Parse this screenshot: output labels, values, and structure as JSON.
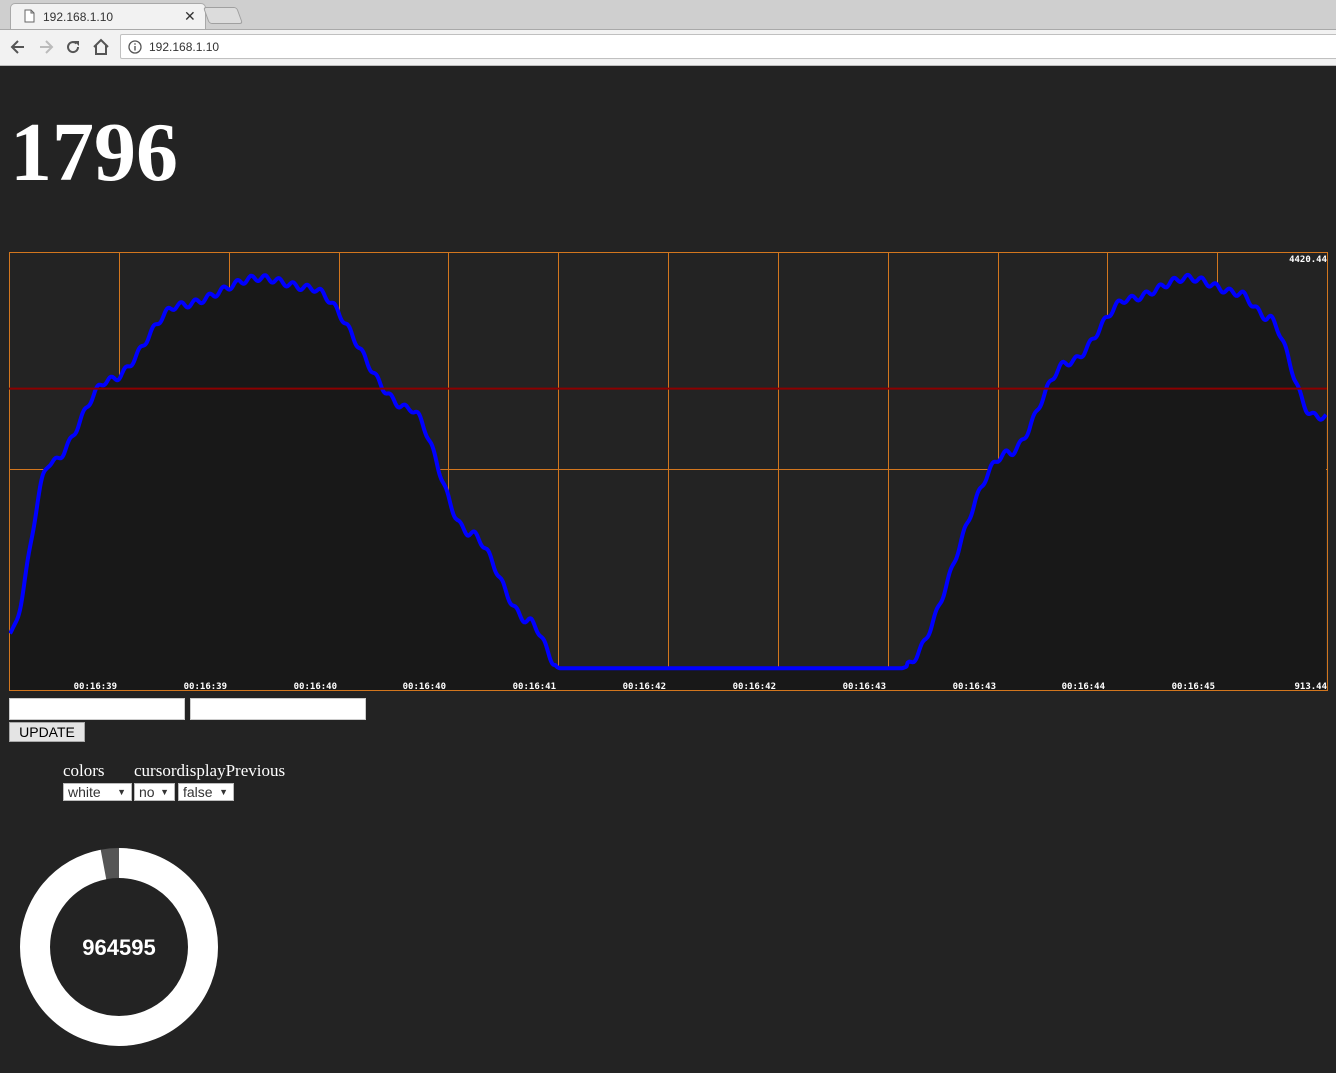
{
  "browser": {
    "tab_title": "192.168.1.10",
    "url": "192.168.1.10"
  },
  "display": {
    "value": "1796"
  },
  "chart_data": {
    "type": "line",
    "ymax_label": "4420.44",
    "ymin_label": "913.44",
    "ylim": [
      913.44,
      4420.44
    ],
    "threshold": 3330,
    "x_ticks": [
      "00:16:39",
      "00:16:39",
      "00:16:40",
      "00:16:40",
      "00:16:41",
      "00:16:42",
      "00:16:42",
      "00:16:43",
      "00:16:43",
      "00:16:44",
      "00:16:45"
    ],
    "series": [
      {
        "color": "#0000ff",
        "points": [
          [
            0,
            1360
          ],
          [
            40,
            2730
          ],
          [
            100,
            3400
          ],
          [
            170,
            4000
          ],
          [
            250,
            4220
          ],
          [
            300,
            4140
          ],
          [
            400,
            3170
          ],
          [
            460,
            2170
          ],
          [
            520,
            1460
          ],
          [
            551,
            1080
          ],
          [
            560,
            1080
          ],
          [
            700,
            1080
          ],
          [
            887,
            1080
          ],
          [
            892,
            1080
          ],
          [
            1000,
            2810
          ],
          [
            1060,
            3540
          ],
          [
            1120,
            4050
          ],
          [
            1180,
            4220
          ],
          [
            1230,
            4100
          ],
          [
            1260,
            3900
          ],
          [
            1306,
            3110
          ],
          [
            1318,
            3100
          ]
        ]
      }
    ],
    "colors": {
      "grid": "#d2761e",
      "threshold_line": "#8b0000",
      "background": "#232323",
      "fill": "#181818"
    }
  },
  "controls": {
    "input1_value": "",
    "input2_value": "",
    "update_label": "UPDATE",
    "labels": {
      "colors": "colors",
      "cursor": "cursordisplayPrevious"
    },
    "selects": {
      "colors": "white",
      "cursor": "no",
      "previous": "false"
    }
  },
  "donut": {
    "value": "964595",
    "fraction": 0.97,
    "ring_color": "#ffffff",
    "remainder_color": "#555555"
  }
}
